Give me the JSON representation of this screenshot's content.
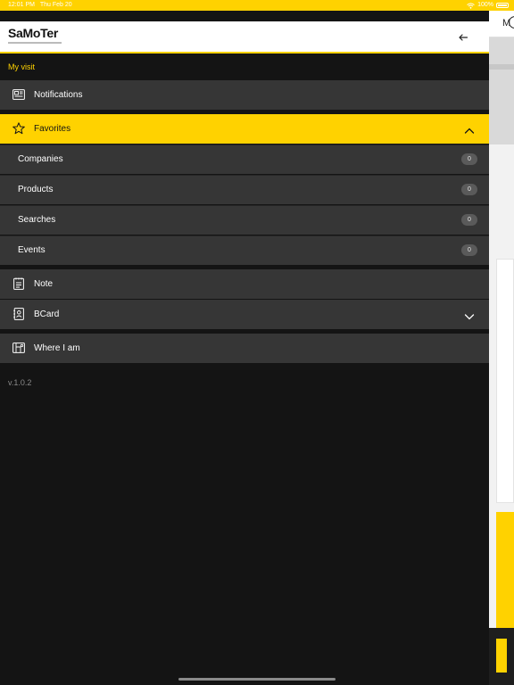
{
  "status_bar": {
    "time": "12:01 PM",
    "date": "Thu Feb 20",
    "battery": "100%",
    "icons": [
      "wifi-icon",
      "battery-icon"
    ]
  },
  "header": {
    "logo_text": "SaMoTer",
    "back_icon": "arrow-left-icon"
  },
  "section": {
    "label": "My visit"
  },
  "menu": {
    "notifications": {
      "label": "Notifications",
      "icon": "newspaper-icon"
    },
    "favorites": {
      "label": "Favorites",
      "icon": "star-icon",
      "expanded": true,
      "items": [
        {
          "label": "Companies",
          "count": "0"
        },
        {
          "label": "Products",
          "count": "0"
        },
        {
          "label": "Searches",
          "count": "0"
        },
        {
          "label": "Events",
          "count": "0"
        }
      ]
    },
    "note": {
      "label": "Note",
      "icon": "notepad-icon"
    },
    "bcard": {
      "label": "BCard",
      "icon": "contact-card-icon",
      "expanded": false
    },
    "where_i_am": {
      "label": "Where I am",
      "icon": "map-icon"
    }
  },
  "version": "v.1.0.2",
  "background_app": {
    "header_text": "M"
  },
  "colors": {
    "accent": "#ffd200",
    "drawer_bg": "#141414",
    "row_bg": "#363636",
    "badge_bg": "#5a5a5a"
  }
}
